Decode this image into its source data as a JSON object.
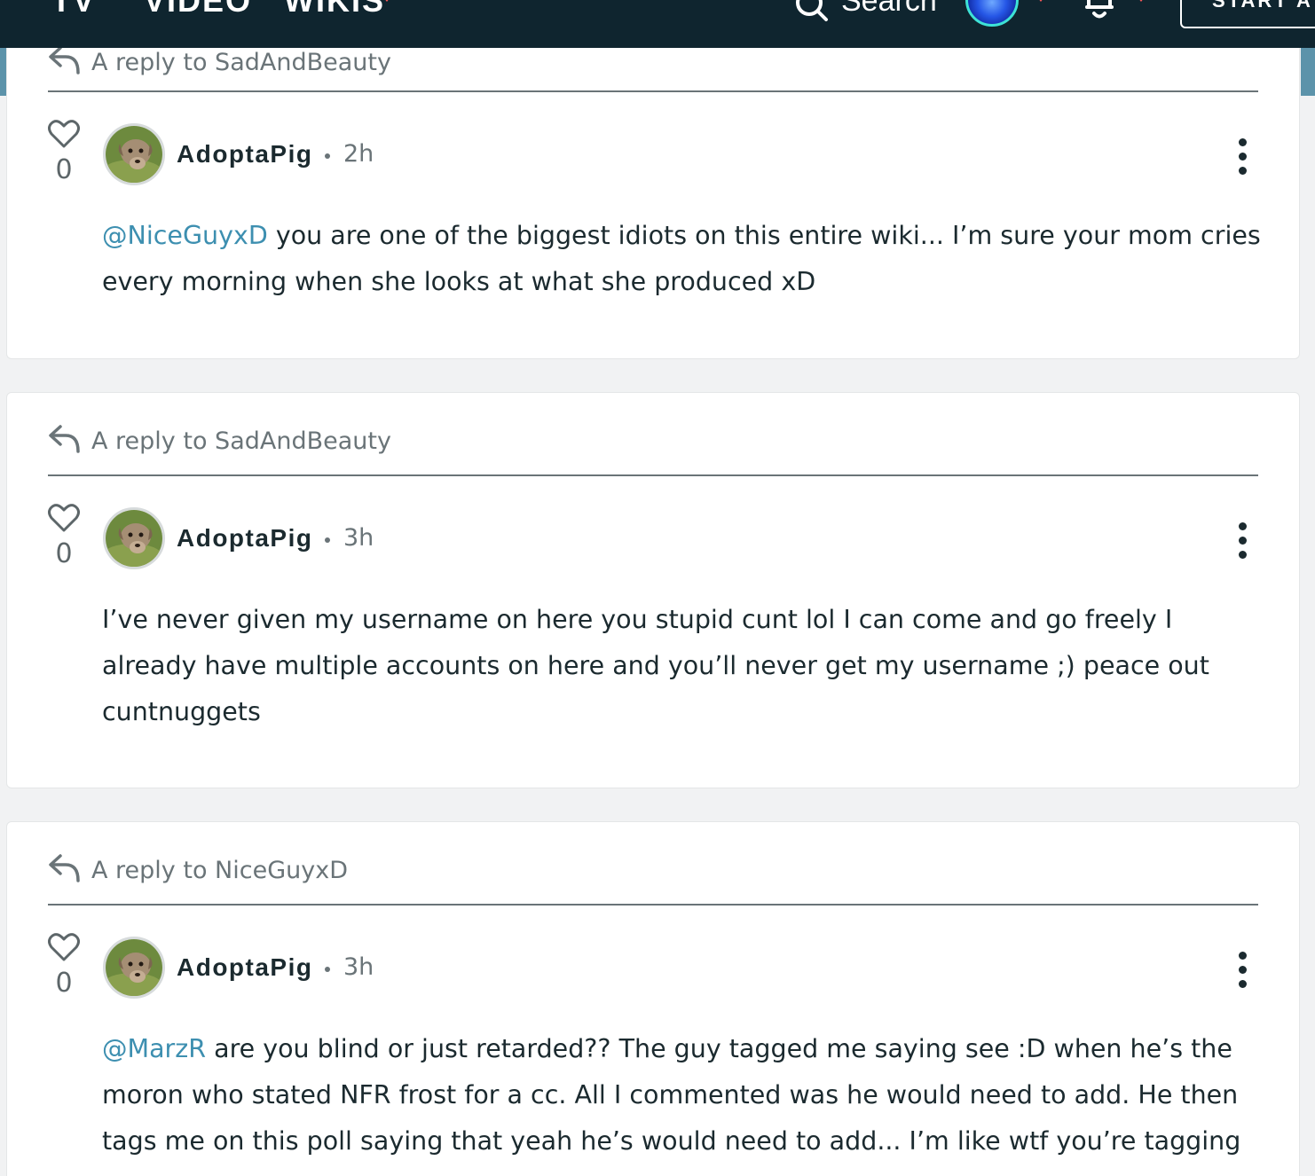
{
  "nav": {
    "links": [
      "TV",
      "VIDEO",
      "WIKIS"
    ],
    "search_label": "Search",
    "start_label": "START A WIKI",
    "accent_color": "#fd585a",
    "bar_color": "#0f252f"
  },
  "comments": [
    {
      "reply_to": "A reply to SadAndBeauty",
      "likes": "0",
      "author": "AdoptaPig",
      "time": "2h",
      "mention": "@NiceGuyxD",
      "text": " you are one of the biggest idiots on this entire wiki... I’m sure your mom cries every morning when she looks at what she produced xD"
    },
    {
      "reply_to": "A reply to SadAndBeauty",
      "likes": "0",
      "author": "AdoptaPig",
      "time": "3h",
      "mention": "",
      "text": "I’ve never given my username on here you stupid cunt lol I can come and go freely I already have multiple accounts on here and you’ll never get my username ;) peace out cuntnuggets"
    },
    {
      "reply_to": "A reply to NiceGuyxD",
      "likes": "0",
      "author": "AdoptaPig",
      "time": "3h",
      "mention": "@MarzR",
      "text": " are you blind or just retarded?? The guy tagged me saying see :D when he’s the moron who stated NFR frost for a cc. All I commented was he would need to add. He then tags me on this poll saying that yeah he’s would need to add... I’m like wtf you’re tagging"
    }
  ]
}
